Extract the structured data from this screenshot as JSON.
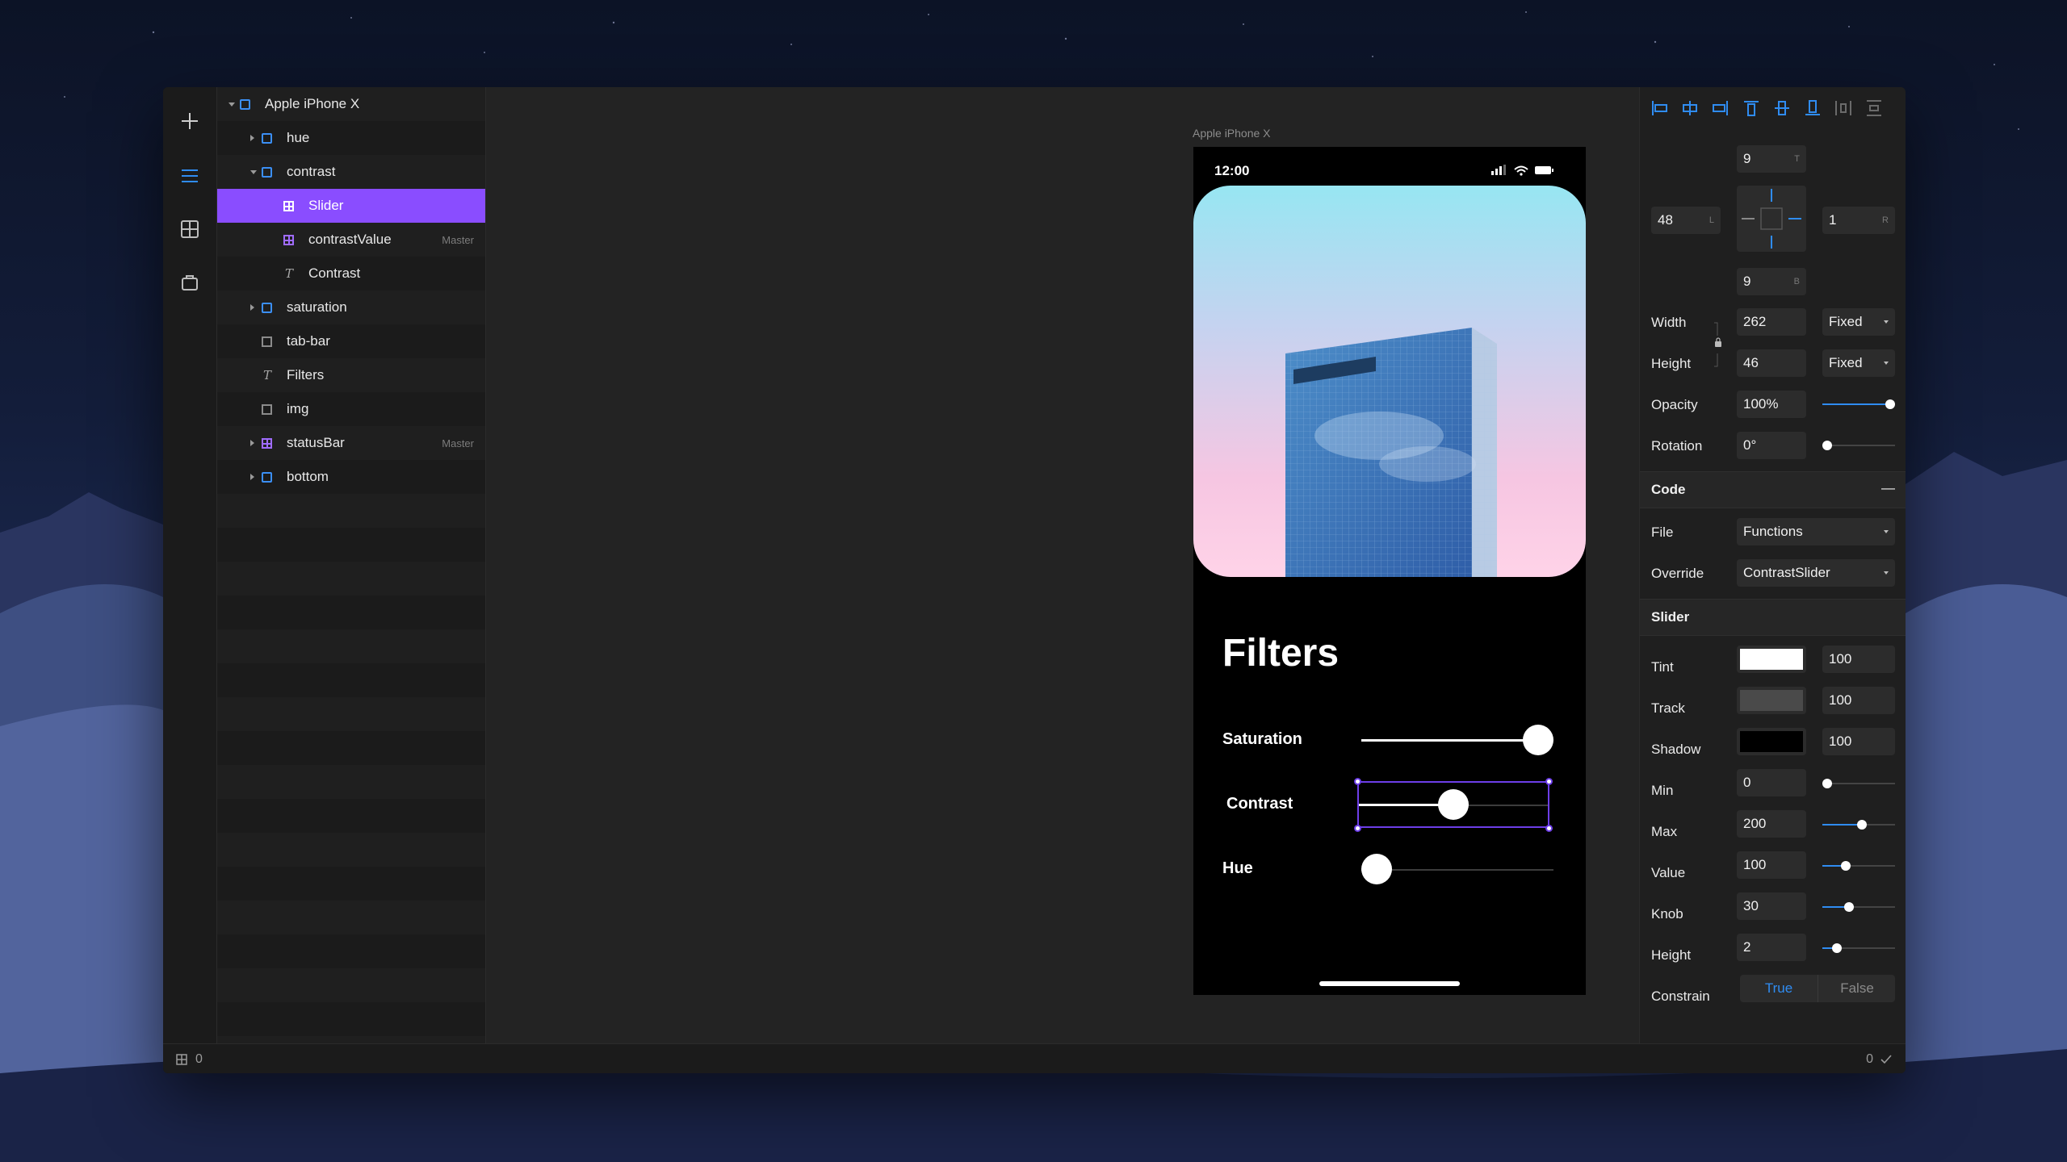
{
  "colors": {
    "accent": "#8a4dff",
    "blue": "#2f8cf2",
    "selection": "#6d3ee8"
  },
  "rail": {
    "icons": [
      "plus-icon",
      "layers-icon",
      "grid-icon",
      "store-icon"
    ]
  },
  "layers": [
    {
      "name": "Apple iPhone X",
      "depth": 0,
      "type": "frame",
      "arrow": "down",
      "badge": ""
    },
    {
      "name": "hue",
      "depth": 1,
      "type": "frame",
      "arrow": "right",
      "badge": ""
    },
    {
      "name": "contrast",
      "depth": 1,
      "type": "frame",
      "arrow": "down",
      "badge": ""
    },
    {
      "name": "Slider",
      "depth": 2,
      "type": "component",
      "arrow": "",
      "badge": "",
      "selected": true
    },
    {
      "name": "contrastValue",
      "depth": 2,
      "type": "component",
      "arrow": "",
      "badge": "Master"
    },
    {
      "name": "Contrast",
      "depth": 2,
      "type": "text",
      "arrow": "",
      "badge": ""
    },
    {
      "name": "saturation",
      "depth": 1,
      "type": "frame",
      "arrow": "right",
      "badge": ""
    },
    {
      "name": "tab-bar",
      "depth": 1,
      "type": "gray",
      "arrow": "",
      "badge": ""
    },
    {
      "name": "Filters",
      "depth": 1,
      "type": "text",
      "arrow": "",
      "badge": ""
    },
    {
      "name": "img",
      "depth": 1,
      "type": "gray",
      "arrow": "",
      "badge": ""
    },
    {
      "name": "statusBar",
      "depth": 1,
      "type": "component",
      "arrow": "right",
      "badge": "Master"
    },
    {
      "name": "bottom",
      "depth": 1,
      "type": "frame",
      "arrow": "right",
      "badge": ""
    }
  ],
  "canvas": {
    "frame_label": "Apple iPhone X",
    "phone": {
      "time": "12:00",
      "title": "Filters",
      "sliders": [
        {
          "label": "Saturation",
          "value": 1.0
        },
        {
          "label": "Contrast",
          "value": 0.5
        },
        {
          "label": "Hue",
          "value": 0.0
        }
      ]
    }
  },
  "props": {
    "pad_top": "9",
    "pad_top_sub": "T",
    "pad_left": "48",
    "pad_left_sub": "L",
    "pad_right": "1",
    "pad_right_sub": "R",
    "pad_bottom": "9",
    "pad_bottom_sub": "B",
    "width_label": "Width",
    "width": "262",
    "width_mode": "Fixed",
    "height_label": "Height",
    "height": "46",
    "height_mode": "Fixed",
    "opacity_label": "Opacity",
    "opacity": "100%",
    "opacity_level": 1.0,
    "rotation_label": "Rotation",
    "rotation": "0°",
    "rotation_level": 0.0,
    "code": {
      "title": "Code",
      "collapse": "—",
      "file_label": "File",
      "file": "Functions",
      "override_label": "Override",
      "override": "ContrastSlider"
    },
    "slider": {
      "title": "Slider",
      "tint_label": "Tint",
      "tint_color": "#ffffff",
      "tint": "100",
      "track_label": "Track",
      "track_color": "#4a4a4a",
      "track": "100",
      "shadow_label": "Shadow",
      "shadow_color": "#000000",
      "shadow": "100",
      "min_label": "Min",
      "min": "0",
      "min_level": 0.0,
      "max_label": "Max",
      "max": "200",
      "max_level": 0.55,
      "value_label": "Value",
      "value": "100",
      "value_level": 0.3,
      "knob_label": "Knob",
      "knob": "30",
      "knob_level": 0.35,
      "height_label": "Height",
      "height": "2",
      "height_level": 0.15,
      "constrain_label": "Constrain",
      "true_label": "True",
      "false_label": "False"
    }
  },
  "bottom": {
    "left_count": "0",
    "right_count": "0"
  }
}
